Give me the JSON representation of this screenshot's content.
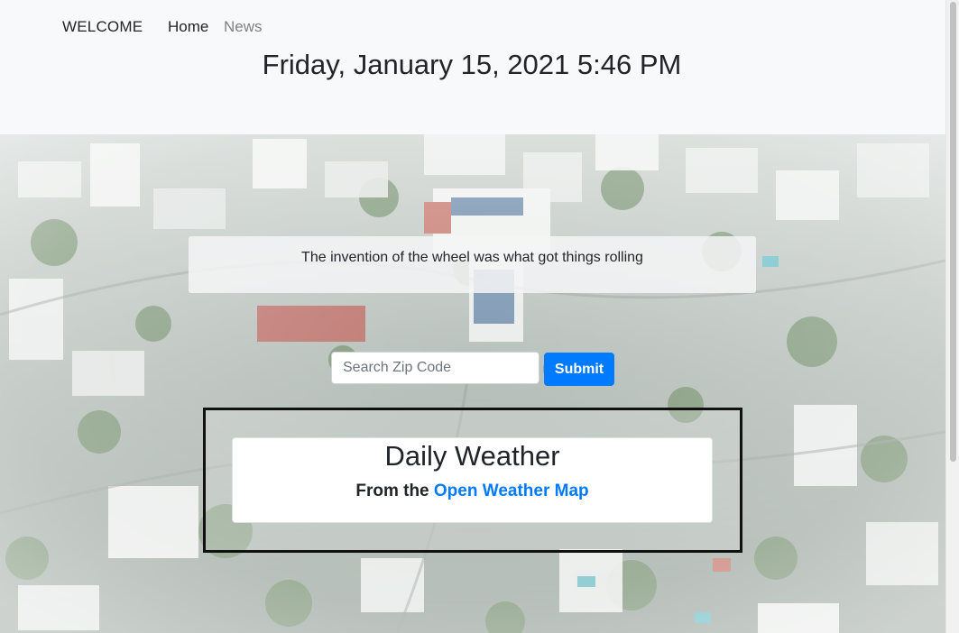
{
  "nav": {
    "brand": "WELCOME",
    "home": "Home",
    "news": "News"
  },
  "header": {
    "datetime": "Friday, January 15, 2021 5:46 PM"
  },
  "quote": {
    "text": "The invention of the wheel was what got things rolling"
  },
  "search": {
    "placeholder": "Search Zip Code",
    "value": "",
    "submit_label": "Submit"
  },
  "weather": {
    "title": "Daily Weather",
    "subtitle_prefix": "From the",
    "link_text": "Open Weather Map"
  },
  "colors": {
    "accent": "#007bff",
    "header_bg": "#f8f9fa",
    "text": "#212529",
    "muted_nav": "#7f8184"
  },
  "background": {
    "image": "aerial-city-panorama"
  }
}
